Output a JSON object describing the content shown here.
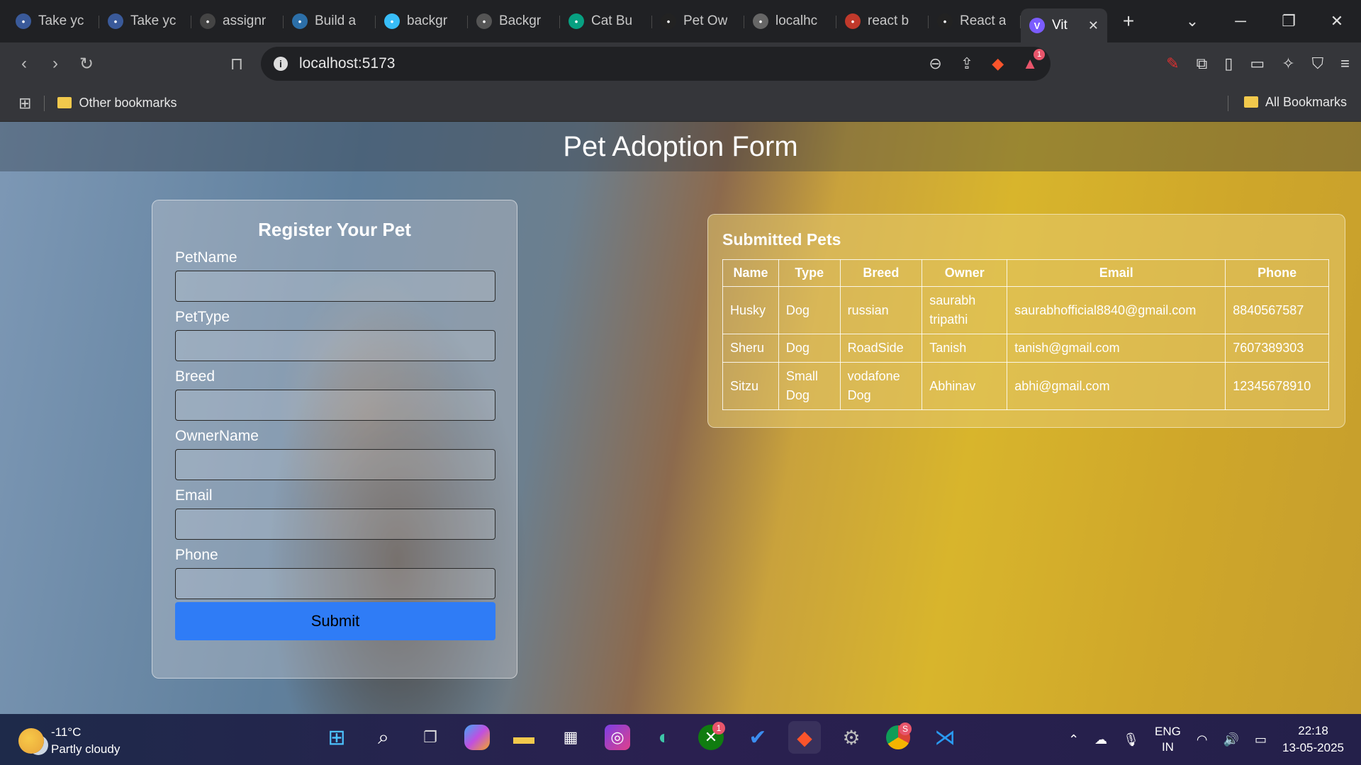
{
  "browser": {
    "tabs": [
      {
        "label": "Take yc",
        "icon": "avatar-icon",
        "color": "#3a5a9a"
      },
      {
        "label": "Take yc",
        "icon": "avatar-icon",
        "color": "#3a5a9a"
      },
      {
        "label": "assignr",
        "icon": "github-icon",
        "color": "#444444"
      },
      {
        "label": "Build a",
        "icon": "react-icon",
        "color": "#2c6fa8"
      },
      {
        "label": "backgr",
        "icon": "tailwind-icon",
        "color": "#38bdf8"
      },
      {
        "label": "Backgr",
        "icon": "openai-icon",
        "color": "#555555"
      },
      {
        "label": "Cat Bu",
        "icon": "pexels-icon",
        "color": "#07a081"
      },
      {
        "label": "Pet Ow",
        "icon": "site-icon",
        "color": "#222222"
      },
      {
        "label": "localhc",
        "icon": "vite-icon",
        "color": "#666666"
      },
      {
        "label": "react b",
        "icon": "brave-search-icon",
        "color": "#c0392b"
      },
      {
        "label": "React a",
        "icon": "medium-icon",
        "color": "#222222"
      }
    ],
    "active_tab": {
      "label": "Vit",
      "icon": "vite-icon"
    },
    "url": "localhost:5173",
    "bookmarks": {
      "left": "Other bookmarks",
      "right": "All Bookmarks"
    },
    "brave_badge": "1"
  },
  "page": {
    "title": "Pet Adoption Form",
    "form": {
      "heading": "Register Your Pet",
      "fields": [
        {
          "label": "PetName",
          "value": ""
        },
        {
          "label": "PetType",
          "value": ""
        },
        {
          "label": "Breed",
          "value": ""
        },
        {
          "label": "OwnerName",
          "value": ""
        },
        {
          "label": "Email",
          "value": ""
        },
        {
          "label": "Phone",
          "value": ""
        }
      ],
      "submit_label": "Submit"
    },
    "table": {
      "heading": "Submitted Pets",
      "columns": [
        "Name",
        "Type",
        "Breed",
        "Owner",
        "Email",
        "Phone"
      ],
      "rows": [
        [
          "Husky",
          "Dog",
          "russian",
          "saurabh tripathi",
          "saurabhofficial8840@gmail.com",
          "8840567587"
        ],
        [
          "Sheru",
          "Dog",
          "RoadSide",
          "Tanish",
          "tanish@gmail.com",
          "7607389303"
        ],
        [
          "Sitzu",
          "Small Dog",
          "vodafone Dog",
          "Abhinav",
          "abhi@gmail.com",
          "12345678910"
        ]
      ]
    }
  },
  "taskbar": {
    "weather_temp": "-11°C",
    "weather_desc": "Partly cloudy",
    "xbox_badge": "1",
    "chrome_badge": "S",
    "lang_1": "ENG",
    "lang_2": "IN",
    "time": "22:18",
    "date": "13-05-2025"
  }
}
